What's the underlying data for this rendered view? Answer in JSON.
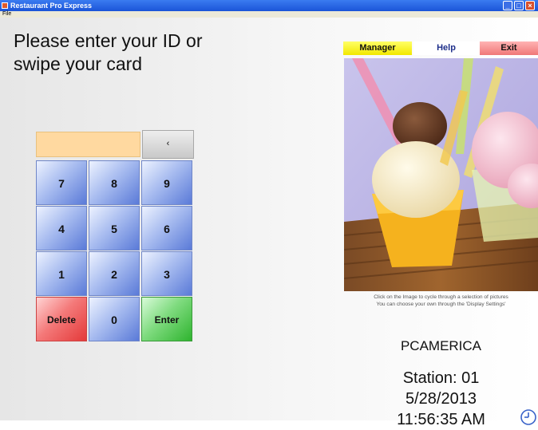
{
  "window": {
    "title": "Restaurant Pro Express",
    "menu": [
      "File"
    ]
  },
  "prompt": {
    "line1": "Please enter your ID or",
    "line2": "swipe your card"
  },
  "keypad": {
    "id_value": "",
    "backspace_label": "‹",
    "keys": [
      "7",
      "8",
      "9",
      "4",
      "5",
      "6",
      "1",
      "2",
      "3"
    ],
    "delete_label": "Delete",
    "zero_label": "0",
    "enter_label": "Enter"
  },
  "top_buttons": {
    "manager": "Manager",
    "help": "Help",
    "exit": "Exit"
  },
  "picture": {
    "caption_line1": "Click on the Image to cycle through a selection of pictures",
    "caption_line2": "You can choose your own through the 'Display Settings'"
  },
  "status": {
    "brand": "PCAMERICA",
    "station": "Station: 01",
    "date": "5/28/2013",
    "time": "11:56:35 AM"
  },
  "icons": {
    "clock": "clock-icon",
    "app": "app-icon",
    "minimize": "minimize-icon",
    "maximize": "maximize-icon",
    "close": "close-icon"
  }
}
